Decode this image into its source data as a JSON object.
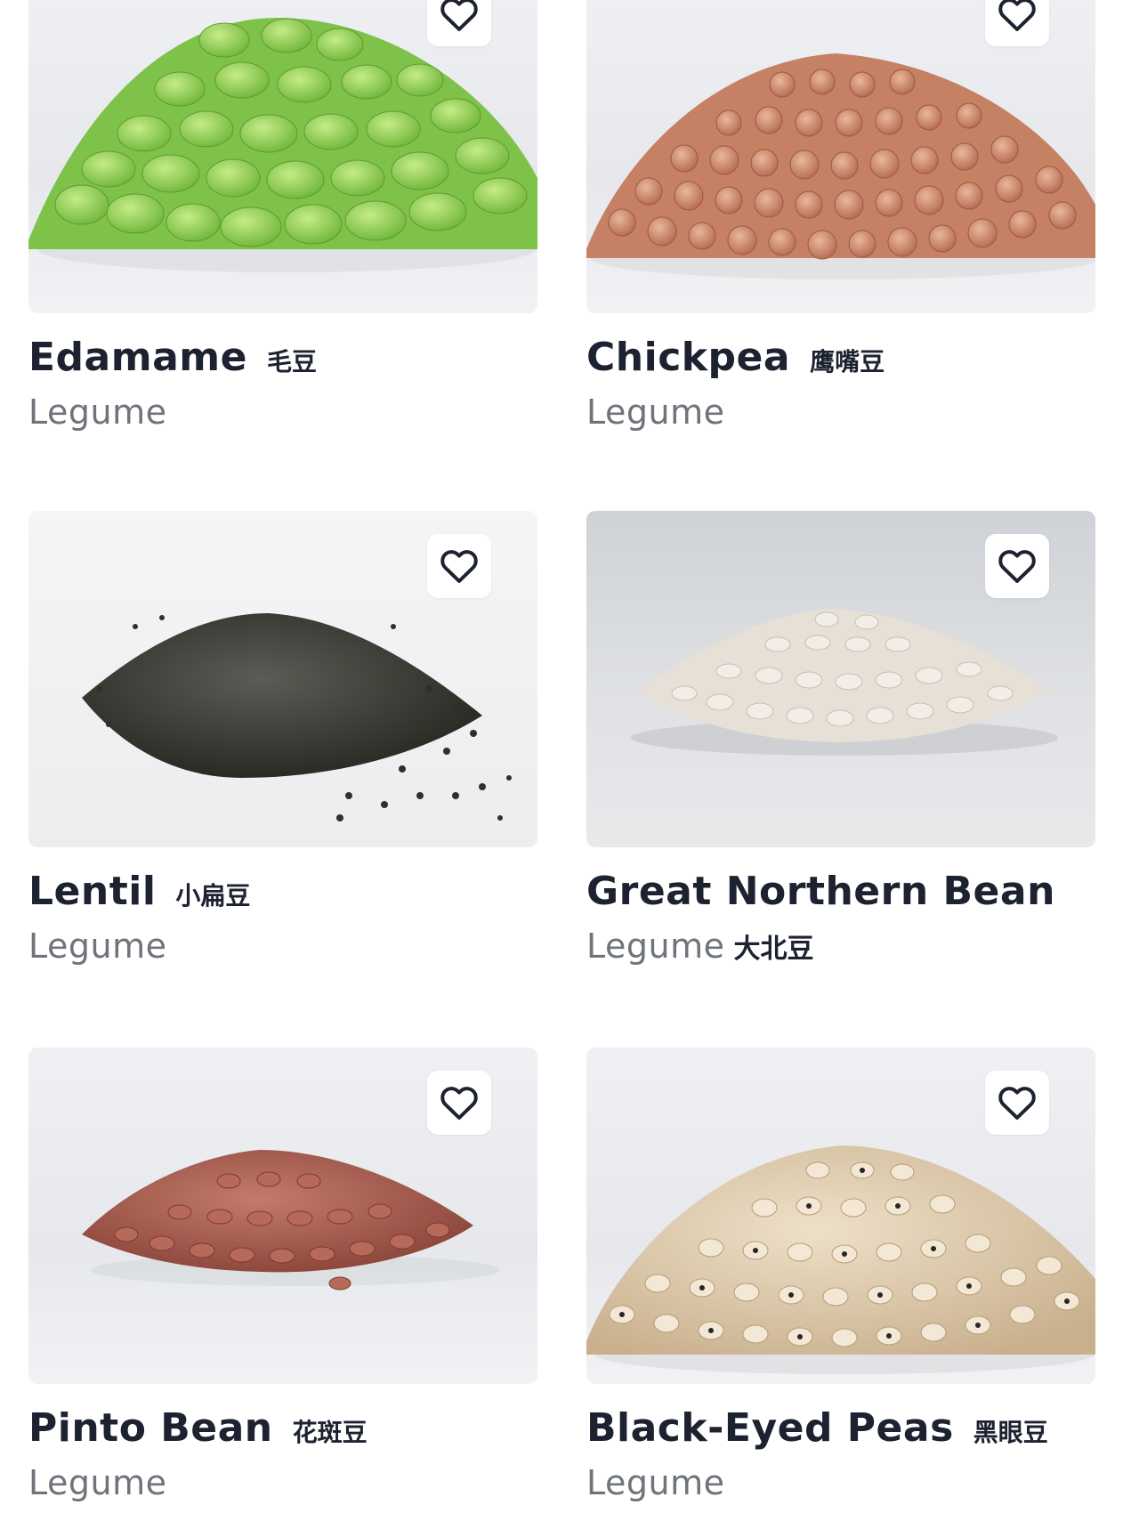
{
  "items": [
    {
      "name": "Edamame",
      "name_cn": "毛豆",
      "category": "Legume",
      "category_cn": "",
      "color": "#8fcf55"
    },
    {
      "name": "Chickpea",
      "name_cn": "鹰嘴豆",
      "category": "Legume",
      "category_cn": "",
      "color": "#c8846a"
    },
    {
      "name": "Lentil",
      "name_cn": "小扁豆",
      "category": "Legume",
      "category_cn": "",
      "color": "#3c3f3a"
    },
    {
      "name": "Great Northern Bean",
      "name_cn": "",
      "category": "Legume",
      "category_cn": "大北豆",
      "color": "#e4ddd2"
    },
    {
      "name": "Pinto Bean",
      "name_cn": "花斑豆",
      "category": "Legume",
      "category_cn": "",
      "color": "#a85a4e"
    },
    {
      "name": "Black-Eyed Peas",
      "name_cn": "黑眼豆",
      "category": "Legume",
      "category_cn": "",
      "color": "#e2cfb4"
    }
  ],
  "icons": {
    "favorite": "heart-outline-icon"
  }
}
